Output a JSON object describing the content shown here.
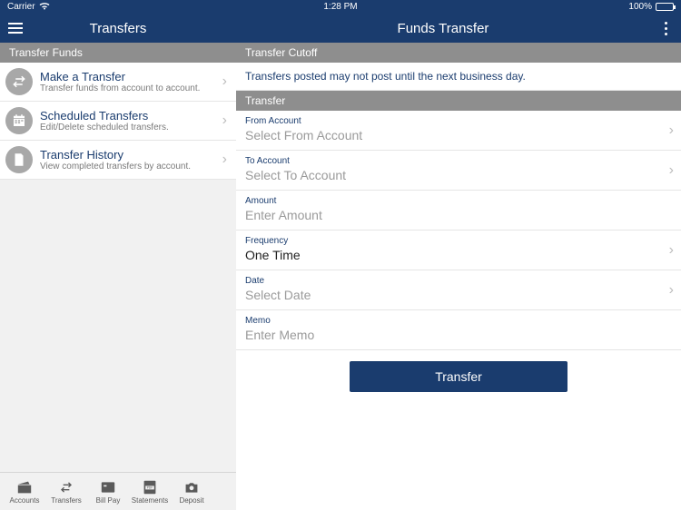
{
  "statusbar": {
    "carrier": "Carrier",
    "time": "1:28 PM",
    "battery_pct": "100%"
  },
  "header": {
    "left_title": "Transfers",
    "right_title": "Funds Transfer"
  },
  "left": {
    "section": "Transfer Funds",
    "items": [
      {
        "title": "Make a Transfer",
        "subtitle": "Transfer funds from account to account.",
        "icon": "transfer-arrows-icon"
      },
      {
        "title": "Scheduled Transfers",
        "subtitle": "Edit/Delete scheduled transfers.",
        "icon": "calendar-icon"
      },
      {
        "title": "Transfer History",
        "subtitle": "View completed transfers by account.",
        "icon": "document-icon"
      }
    ]
  },
  "right": {
    "cutoff_header": "Transfer Cutoff",
    "cutoff_text": "Transfers posted may not post until the next business day.",
    "form_header": "Transfer",
    "fields": {
      "from": {
        "label": "From Account",
        "placeholder": "Select From Account",
        "value": ""
      },
      "to": {
        "label": "To Account",
        "placeholder": "Select To Account",
        "value": ""
      },
      "amount": {
        "label": "Amount",
        "placeholder": "Enter Amount",
        "value": ""
      },
      "frequency": {
        "label": "Frequency",
        "placeholder": "",
        "value": "One Time"
      },
      "date": {
        "label": "Date",
        "placeholder": "Select Date",
        "value": ""
      },
      "memo": {
        "label": "Memo",
        "placeholder": "Enter Memo",
        "value": ""
      }
    },
    "submit_label": "Transfer"
  },
  "bottombar": {
    "tabs": [
      {
        "label": "Accounts",
        "icon": "wallet-icon"
      },
      {
        "label": "Transfers",
        "icon": "transfer-arrows-icon"
      },
      {
        "label": "Bill Pay",
        "icon": "billpay-icon"
      },
      {
        "label": "Statements",
        "icon": "pdf-icon"
      },
      {
        "label": "Deposit",
        "icon": "camera-icon"
      }
    ]
  }
}
